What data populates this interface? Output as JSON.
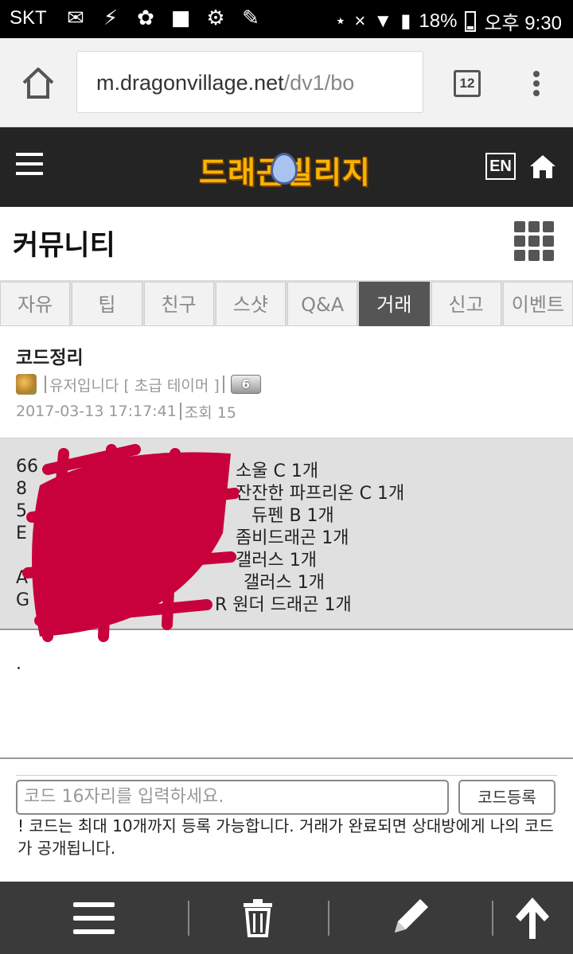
{
  "status_bar": {
    "carrier": "SKT",
    "battery": "18%",
    "time": "오후 9:30"
  },
  "browser": {
    "url_domain": "m.dragonvillage.net",
    "url_path": "/dv1/bo",
    "tab_count": "12"
  },
  "header": {
    "logo_text": "드래곤빌리지",
    "lang_label": "EN"
  },
  "board": {
    "title": "커뮤니티",
    "tabs": [
      {
        "label": "자유"
      },
      {
        "label": "팁"
      },
      {
        "label": "친구"
      },
      {
        "label": "스샷"
      },
      {
        "label": "Q&A"
      },
      {
        "label": "거래"
      },
      {
        "label": "신고"
      },
      {
        "label": "이벤트"
      }
    ],
    "active_tab": "거래"
  },
  "post": {
    "title": "코드정리",
    "author": "유저입니다 [ 초급 테이머 ]",
    "level": "6",
    "date": "2017-03-13 17:17:41",
    "views": "조회 15",
    "lines": [
      {
        "prefix": "66",
        "suffix": "소울 C 1개"
      },
      {
        "prefix": "8",
        "suffix": "잔잔한 파프리온 C 1개"
      },
      {
        "prefix": "5",
        "suffix": "듀펜 B 1개"
      },
      {
        "prefix": "E",
        "suffix": "좀비드래곤 1개"
      },
      {
        "prefix": "",
        "suffix": "갤러스 1개"
      },
      {
        "prefix": "A",
        "suffix": "갤러스 1개"
      },
      {
        "prefix": "G",
        "suffix": "R 원더 드래곤 1개"
      }
    ],
    "trailing": "."
  },
  "code_form": {
    "placeholder": "코드 16자리를 입력하세요.",
    "button_label": "코드등록",
    "notice": "! 코드는 최대 10개까지 등록 가능합니다. 거래가 완료되면 상대방에게 나의 코드가 공개됩니다."
  },
  "colors": {
    "header_bg": "#242424",
    "active_tab_bg": "#555555",
    "redaction": "#c8003c",
    "bottom_bar_bg": "#3a3a3a"
  }
}
